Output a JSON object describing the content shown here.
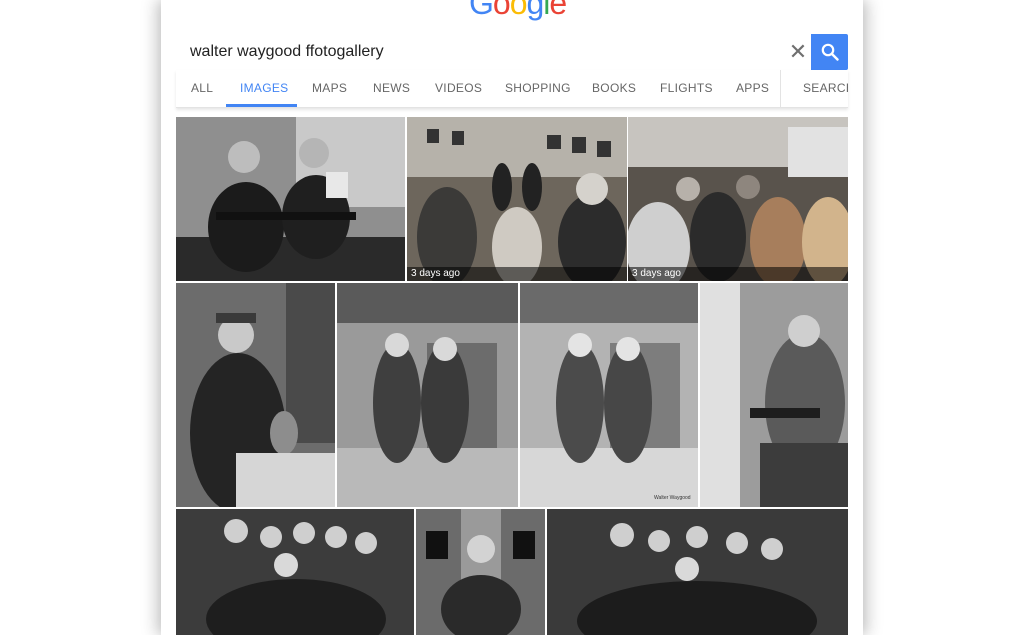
{
  "logo": {
    "letters": [
      {
        "char": "G",
        "color": "#4285f4"
      },
      {
        "char": "o",
        "color": "#ea4335"
      },
      {
        "char": "o",
        "color": "#fbbc05"
      },
      {
        "char": "g",
        "color": "#4285f4"
      },
      {
        "char": "l",
        "color": "#34a853"
      },
      {
        "char": "e",
        "color": "#ea4335"
      }
    ]
  },
  "search": {
    "query": "walter waygood ffotogallery",
    "clear_icon": "close-icon",
    "submit_icon": "search-icon",
    "accent": "#4285f4"
  },
  "tabs": [
    {
      "label": "ALL"
    },
    {
      "label": "IMAGES"
    },
    {
      "label": "MAPS"
    },
    {
      "label": "NEWS"
    },
    {
      "label": "VIDEOS"
    },
    {
      "label": "SHOPPING"
    },
    {
      "label": "BOOKS"
    },
    {
      "label": "FLIGHTS"
    },
    {
      "label": "APPS"
    },
    {
      "label": "SEARCH"
    }
  ],
  "active_tab": "IMAGES",
  "results": [
    {
      "badge": ""
    },
    {
      "badge": "3 days ago"
    },
    {
      "badge": "3 days ago"
    },
    {
      "badge": ""
    },
    {
      "badge": ""
    },
    {
      "badge": ""
    },
    {
      "badge": ""
    },
    {
      "badge": ""
    },
    {
      "badge": ""
    },
    {
      "badge": ""
    }
  ],
  "photo_caption": "Walter Waygood"
}
